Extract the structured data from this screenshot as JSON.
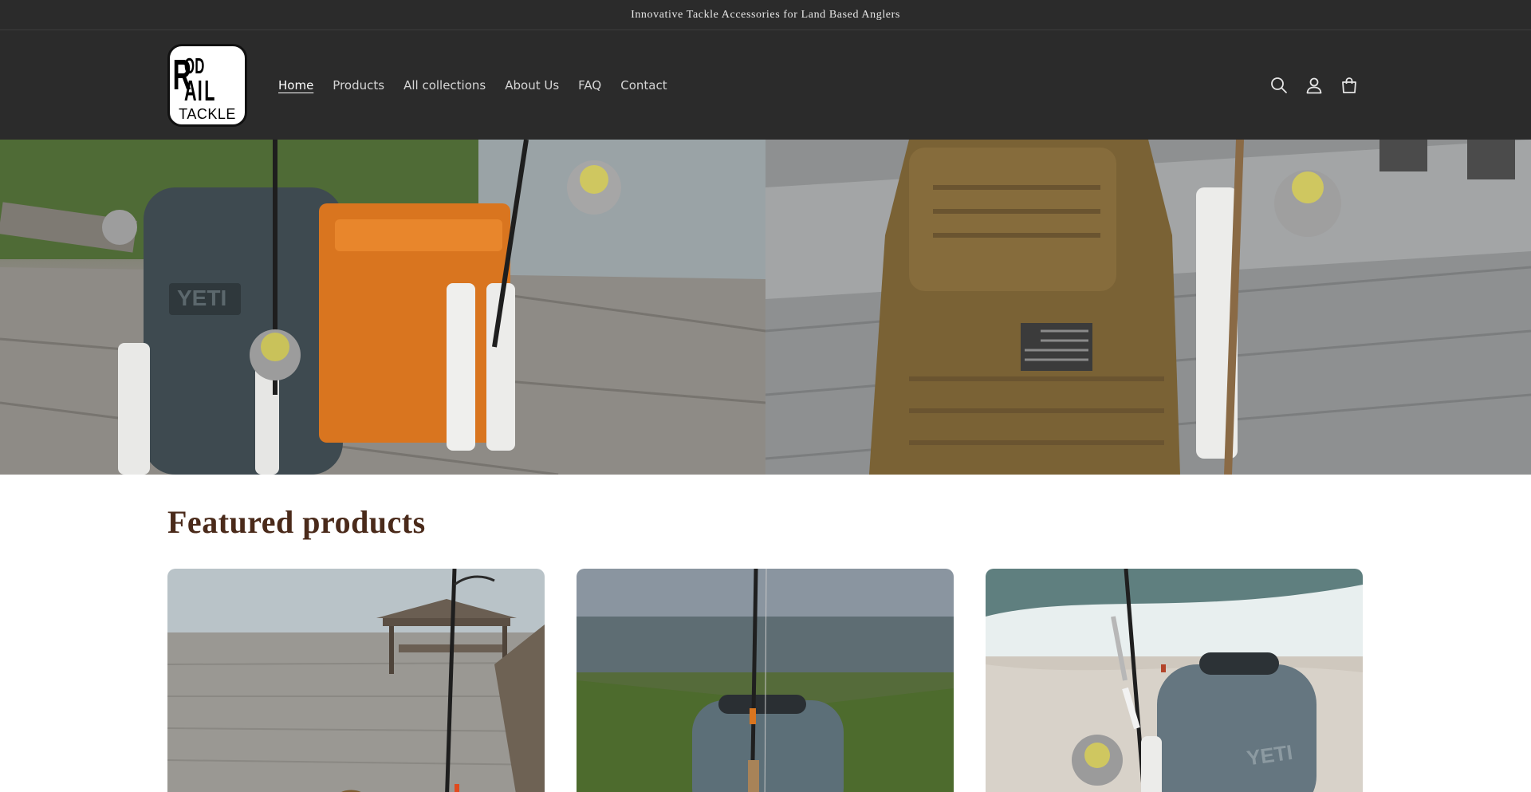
{
  "announcement": {
    "text": "Innovative Tackle Accessories for Land Based Anglers"
  },
  "brand": {
    "logo_mark": "RodRail",
    "logo_word": "TACKLE"
  },
  "nav": {
    "items": [
      {
        "label": "Home",
        "active": true
      },
      {
        "label": "Products",
        "active": false
      },
      {
        "label": "All collections",
        "active": false
      },
      {
        "label": "About Us",
        "active": false
      },
      {
        "label": "FAQ",
        "active": false
      },
      {
        "label": "Contact",
        "active": false
      }
    ]
  },
  "header_icons": [
    "search-icon",
    "account-icon",
    "cart-icon"
  ],
  "featured": {
    "title": "Featured products"
  },
  "colors": {
    "header_bg": "#2b2b2b",
    "section_title": "#4a2a1a",
    "accent_orange": "#d9751f"
  }
}
